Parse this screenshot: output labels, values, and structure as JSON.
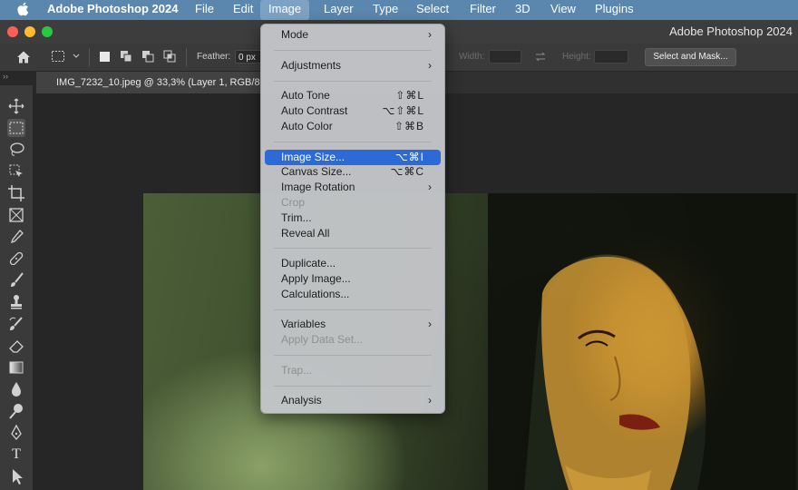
{
  "menubar": {
    "app_name": "Adobe Photoshop 2024",
    "items": [
      "File",
      "Edit",
      "Image",
      "Layer",
      "Type",
      "Select",
      "Filter",
      "3D",
      "View",
      "Plugins"
    ],
    "active_item": "Image"
  },
  "window": {
    "title": "Adobe Photoshop 2024"
  },
  "options_bar": {
    "feather_label": "Feather:",
    "feather_value": "0 px",
    "width_label": "Width:",
    "height_label": "Height:",
    "select_mask_label": "Select and Mask..."
  },
  "document": {
    "tab_title": "IMG_7232_10.jpeg @ 33,3% (Layer 1, RGB/8"
  },
  "image_menu": {
    "items": [
      {
        "label": "Mode",
        "shortcut": "",
        "submenu": true,
        "disabled": false
      },
      {
        "label": "Adjustments",
        "shortcut": "",
        "submenu": true,
        "disabled": false
      },
      {
        "label": "Auto Tone",
        "shortcut": "⇧⌘L",
        "submenu": false,
        "disabled": false
      },
      {
        "label": "Auto Contrast",
        "shortcut": "⌥⇧⌘L",
        "submenu": false,
        "disabled": false
      },
      {
        "label": "Auto Color",
        "shortcut": "⇧⌘B",
        "submenu": false,
        "disabled": false
      },
      {
        "label": "Image Size...",
        "shortcut": "⌥⌘I",
        "submenu": false,
        "disabled": false,
        "highlighted": true
      },
      {
        "label": "Canvas Size...",
        "shortcut": "⌥⌘C",
        "submenu": false,
        "disabled": false
      },
      {
        "label": "Image Rotation",
        "shortcut": "",
        "submenu": true,
        "disabled": false
      },
      {
        "label": "Crop",
        "shortcut": "",
        "submenu": false,
        "disabled": true
      },
      {
        "label": "Trim...",
        "shortcut": "",
        "submenu": false,
        "disabled": false
      },
      {
        "label": "Reveal All",
        "shortcut": "",
        "submenu": false,
        "disabled": false
      },
      {
        "label": "Duplicate...",
        "shortcut": "",
        "submenu": false,
        "disabled": false
      },
      {
        "label": "Apply Image...",
        "shortcut": "",
        "submenu": false,
        "disabled": false
      },
      {
        "label": "Calculations...",
        "shortcut": "",
        "submenu": false,
        "disabled": false
      },
      {
        "label": "Variables",
        "shortcut": "",
        "submenu": true,
        "disabled": false
      },
      {
        "label": "Apply Data Set...",
        "shortcut": "",
        "submenu": false,
        "disabled": true
      },
      {
        "label": "Trap...",
        "shortcut": "",
        "submenu": false,
        "disabled": true
      },
      {
        "label": "Analysis",
        "shortcut": "",
        "submenu": true,
        "disabled": false
      }
    ],
    "submenu_arrow": "›"
  },
  "toolbar": {
    "tools": [
      "move-tool-icon",
      "rectangular-marquee-icon",
      "lasso-icon",
      "object-selection-icon",
      "crop-icon",
      "frame-icon",
      "eyedropper-icon",
      "healing-brush-icon",
      "brush-icon",
      "clone-stamp-icon",
      "history-brush-icon",
      "eraser-icon",
      "gradient-icon",
      "blur-icon",
      "dodge-icon",
      "pen-icon",
      "type-icon",
      "path-selection-icon"
    ],
    "type_glyph": "T",
    "active_tool": "rectangular-marquee-icon"
  },
  "colors": {
    "menubar_bg": "#5b86ad",
    "menu_bg": "#c4c6c9",
    "highlight": "#2c6bd7",
    "panel_bg": "#3a3a3a"
  }
}
